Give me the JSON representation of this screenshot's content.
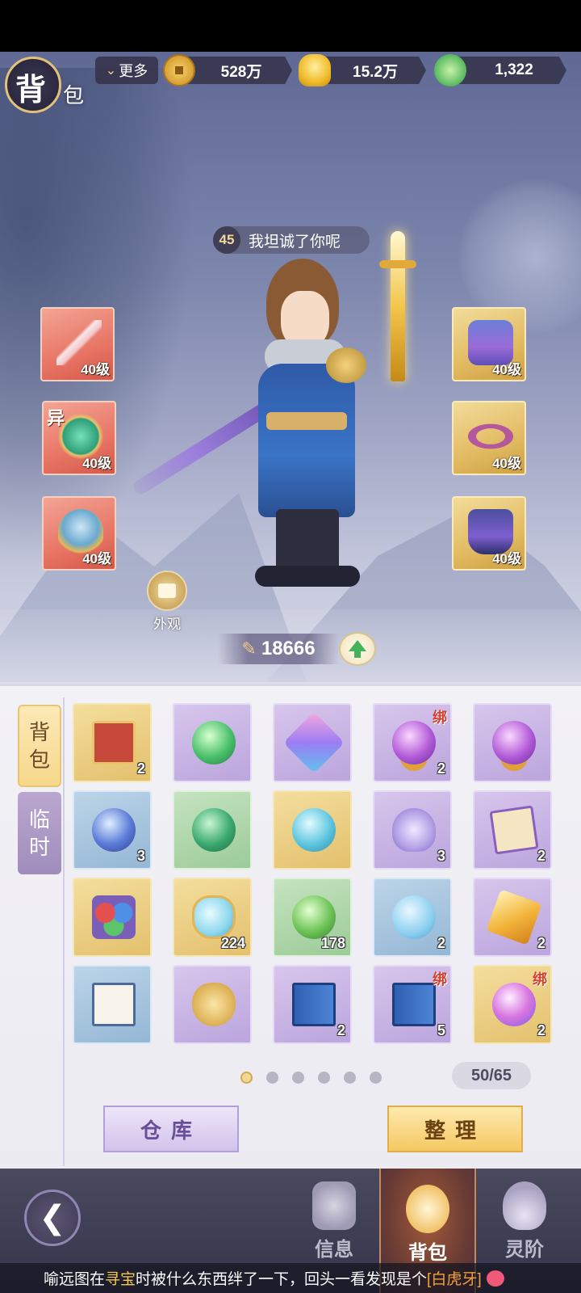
{
  "title": {
    "main": "背",
    "sub": "包"
  },
  "topbar": {
    "more_label": "更多",
    "chevron_glyph": "⌄",
    "currencies": [
      {
        "name": "copper-coin",
        "value": "528万"
      },
      {
        "name": "gold-ingot",
        "value": "15.2万"
      },
      {
        "name": "jade",
        "value": "1,322"
      }
    ]
  },
  "character": {
    "level": "45",
    "name": "我坦诚了你呢"
  },
  "equipment": {
    "left": [
      {
        "name": "weapon",
        "level": "40级",
        "tag": ""
      },
      {
        "name": "pendant",
        "level": "40级",
        "tag": "异"
      },
      {
        "name": "helmet",
        "level": "40级",
        "tag": ""
      }
    ],
    "right": [
      {
        "name": "armor",
        "level": "40级"
      },
      {
        "name": "ring",
        "level": "40级"
      },
      {
        "name": "boots",
        "level": "40级"
      }
    ]
  },
  "appearance_label": "外观",
  "power": {
    "icon_glyph": "✎",
    "value": "18666"
  },
  "bag_tabs": [
    {
      "label_line1": "背",
      "label_line2": "包",
      "active": true
    },
    {
      "label_line1": "临",
      "label_line2": "时",
      "active": false
    }
  ],
  "items": [
    {
      "icon": "taiji-book-icon",
      "count": "2",
      "bound": "",
      "rarity": "gold"
    },
    {
      "icon": "green-orb-icon",
      "count": "",
      "bound": "",
      "rarity": "purple"
    },
    {
      "icon": "gem-icon",
      "count": "",
      "bound": "",
      "rarity": "purple"
    },
    {
      "icon": "purple-orb-icon",
      "count": "2",
      "bound": "绑",
      "rarity": "purple"
    },
    {
      "icon": "purple-orb-icon",
      "count": "",
      "bound": "",
      "rarity": "purple"
    },
    {
      "icon": "blue-orb-icon",
      "count": "3",
      "bound": "",
      "rarity": "blue"
    },
    {
      "icon": "jade-orb-icon",
      "count": "",
      "bound": "",
      "rarity": "green"
    },
    {
      "icon": "cyan-orb-icon",
      "count": "",
      "bound": "",
      "rarity": "gold"
    },
    {
      "icon": "lotus-icon",
      "count": "3",
      "bound": "",
      "rarity": "purple"
    },
    {
      "icon": "scroll-icon",
      "count": "2",
      "bound": "",
      "rarity": "purple"
    },
    {
      "icon": "three-balls-icon",
      "count": "",
      "bound": "",
      "rarity": "gold"
    },
    {
      "icon": "flask-icon",
      "count": "224",
      "bound": "",
      "rarity": "gold"
    },
    {
      "icon": "leaf-orb-icon",
      "count": "178",
      "bound": "",
      "rarity": "green"
    },
    {
      "icon": "sword-bubble-icon",
      "count": "2",
      "bound": "",
      "rarity": "blue"
    },
    {
      "icon": "crystal-icon",
      "count": "2",
      "bound": "",
      "rarity": "purple"
    },
    {
      "icon": "manual-icon",
      "count": "",
      "bound": "",
      "rarity": "blue"
    },
    {
      "icon": "token-icon",
      "count": "",
      "bound": "",
      "rarity": "purple"
    },
    {
      "icon": "exp-tome-icon",
      "count": "2",
      "bound": "",
      "rarity": "purple"
    },
    {
      "icon": "exp-tome-icon",
      "count": "5",
      "bound": "绑",
      "rarity": "purple"
    },
    {
      "icon": "peach-icon",
      "count": "2",
      "bound": "绑",
      "rarity": "gold"
    }
  ],
  "pagination": {
    "pages": 6,
    "current": 1
  },
  "capacity": "50/65",
  "buttons": {
    "warehouse": "仓库",
    "sort": "整理"
  },
  "nav": {
    "back_glyph": "❮",
    "info": "信息",
    "bag": "背包",
    "tier": "灵阶"
  },
  "ticker": {
    "part1": "喻远图在",
    "highlight1": "寻宝",
    "part2": "时被什么东西绊了一下，回头一看发现是个",
    "highlight2": "[白虎牙]"
  },
  "colors": {
    "gold_frame": "#e2c27a",
    "bind_red": "#d6402e",
    "power_green": "#46b25a"
  }
}
